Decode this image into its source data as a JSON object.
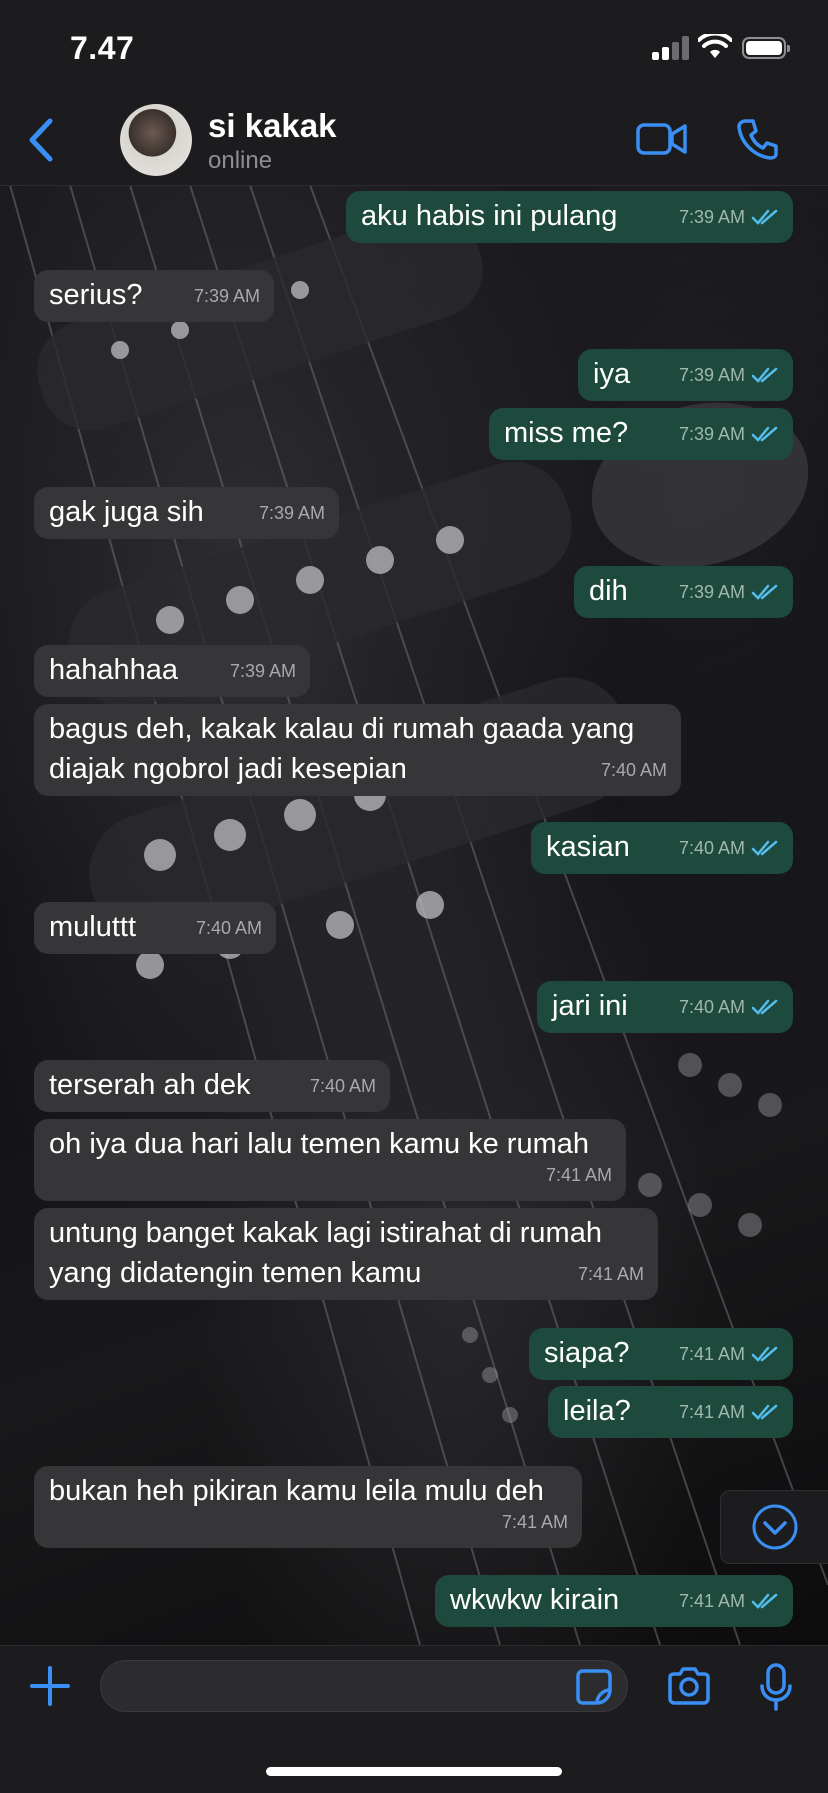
{
  "status_bar": {
    "time": "7.47"
  },
  "header": {
    "contact_name": "si kakak",
    "contact_status": "online"
  },
  "icons": {
    "back": "chevron-left-icon",
    "video": "video-camera-icon",
    "call": "phone-icon",
    "plus": "plus-icon",
    "sticker": "sticker-icon",
    "camera": "camera-icon",
    "mic": "microphone-icon",
    "scroll": "chevron-down-circle-icon",
    "read": "double-check-icon"
  },
  "colors": {
    "accent": "#3a8ff5",
    "outgoing_bubble": "#1e4a3e",
    "incoming_bubble": "#363638",
    "read_ticks": "#53bdeb"
  },
  "messages": [
    {
      "dir": "out",
      "text": "aku habis ini pulang",
      "time": "7:39 AM",
      "read": true
    },
    {
      "dir": "in",
      "text": "serius?",
      "time": "7:39 AM"
    },
    {
      "dir": "out",
      "text": "iya",
      "time": "7:39 AM",
      "read": true
    },
    {
      "dir": "out",
      "text": "miss me?",
      "time": "7:39 AM",
      "read": true
    },
    {
      "dir": "in",
      "text": "gak juga sih",
      "time": "7:39 AM"
    },
    {
      "dir": "out",
      "text": "dih",
      "time": "7:39 AM",
      "read": true
    },
    {
      "dir": "in",
      "text": "hahahhaa",
      "time": "7:39 AM"
    },
    {
      "dir": "in",
      "text": "bagus deh, kakak kalau di rumah gaada yang",
      "text2": "diajak ngobrol jadi kesepian",
      "time": "7:40 AM"
    },
    {
      "dir": "out",
      "text": "kasian",
      "time": "7:40 AM",
      "read": true
    },
    {
      "dir": "in",
      "text": "muluttt",
      "time": "7:40 AM"
    },
    {
      "dir": "out",
      "text": "jari ini",
      "time": "7:40 AM",
      "read": true
    },
    {
      "dir": "in",
      "text": "terserah ah dek",
      "time": "7:40 AM"
    },
    {
      "dir": "in",
      "text": "oh iya dua hari lalu temen kamu ke rumah",
      "time": "7:41 AM"
    },
    {
      "dir": "in",
      "text": "untung banget kakak lagi istirahat di rumah",
      "text2": "yang didatengin temen kamu",
      "time": "7:41 AM"
    },
    {
      "dir": "out",
      "text": "siapa?",
      "time": "7:41 AM",
      "read": true
    },
    {
      "dir": "out",
      "text": "leila?",
      "time": "7:41 AM",
      "read": true
    },
    {
      "dir": "in",
      "text": "bukan heh pikiran kamu leila mulu deh",
      "time": "7:41 AM"
    },
    {
      "dir": "out",
      "text": "wkwkw kirain",
      "time": "7:41 AM",
      "read": true
    }
  ],
  "composer": {
    "value": ""
  }
}
